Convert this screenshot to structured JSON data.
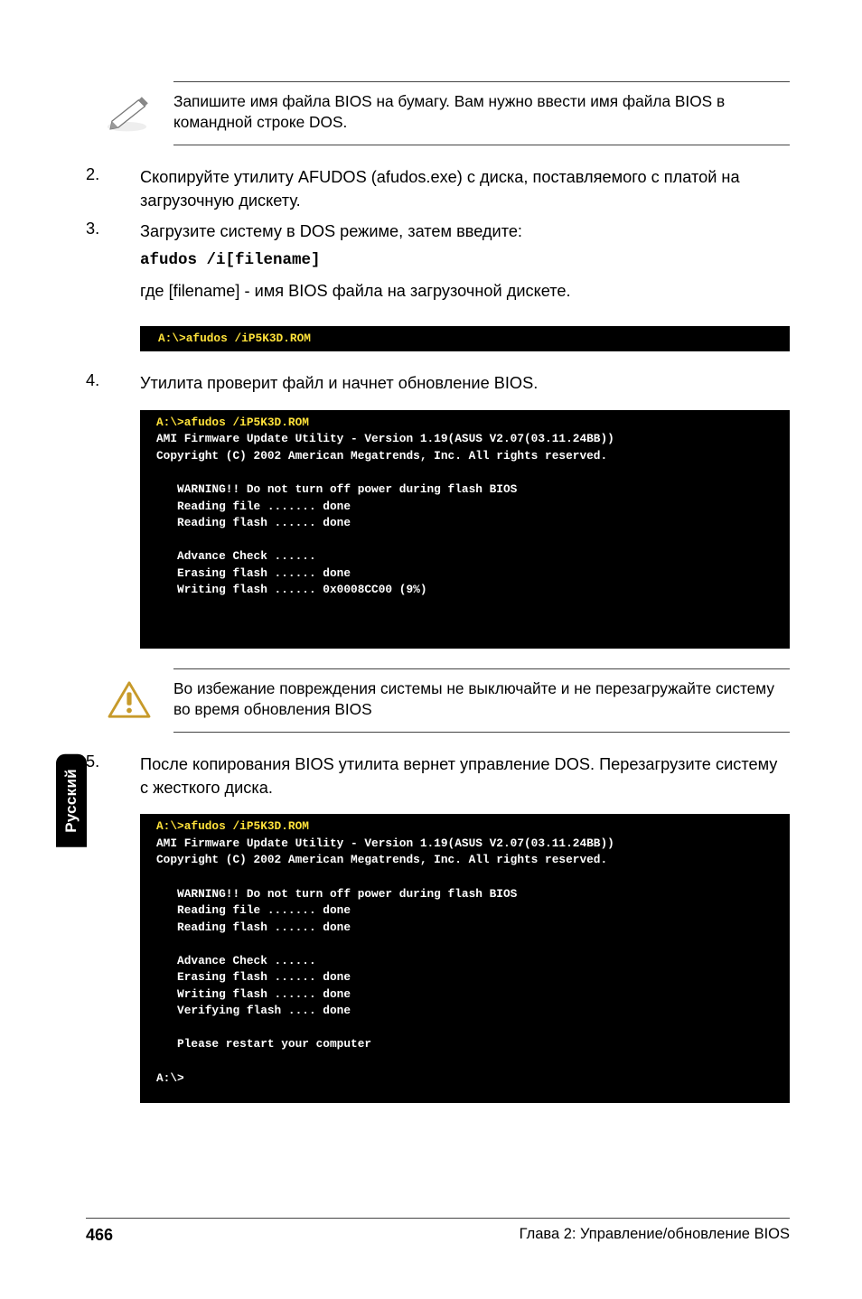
{
  "note": {
    "icon": "pencil-icon",
    "text": "Запишите имя файла BIOS на бумагу. Вам нужно ввести имя файла BIOS в командной строке DOS."
  },
  "step2": {
    "num": "2.",
    "text": "Скопируйте утилиту AFUDOS  (afudos.exe) с диска, поставляемого с платой на загрузочную дискету."
  },
  "step3": {
    "num": "3.",
    "text": "Загрузите систему в DOS режиме, затем введите:"
  },
  "cmd_example": "afudos /i[filename]",
  "where_line": "где [filename] - имя BIOS файла на загрузочной дискете.",
  "term1": {
    "cmd": "A:\\>afudos /iP5K3D.ROM"
  },
  "step4": {
    "num": "4.",
    "text": "Утилита проверит файл и начнет обновление BIOS."
  },
  "term2": {
    "cmd": "A:\\>afudos /iP5K3D.ROM",
    "line1": "AMI Firmware Update Utility - Version 1.19(ASUS V2.07(03.11.24BB))",
    "line2": "Copyright (C) 2002 American Megatrends, Inc. All rights reserved.",
    "b1": "   WARNING!! Do not turn off power during flash BIOS",
    "b2": "   Reading file ....... done",
    "b3": "   Reading flash ...... done",
    "b4": "   Advance Check ......",
    "b5": "   Erasing flash ...... done",
    "b6": "   Writing flash ...... 0x0008CC00 (9%)"
  },
  "warning": {
    "text": "Во избежание повреждения системы не выключайте и не перезагружайте систему во время обновления BIOS"
  },
  "step5": {
    "num": "5.",
    "text": "После копирования BIOS утилита вернет управление DOS. Перезагрузите систему с жесткого диска."
  },
  "term3": {
    "cmd": "A:\\>afudos /iP5K3D.ROM",
    "line1": "AMI Firmware Update Utility - Version 1.19(ASUS V2.07(03.11.24BB))",
    "line2": "Copyright (C) 2002 American Megatrends, Inc. All rights reserved.",
    "b1": "   WARNING!! Do not turn off power during flash BIOS",
    "b2": "   Reading file ....... done",
    "b3": "   Reading flash ...... done",
    "b4": "   Advance Check ......",
    "b5": "   Erasing flash ...... done",
    "b6": "   Writing flash ...... done",
    "b7": "   Verifying flash .... done",
    "b8": "   Please restart your computer",
    "prompt": "A:\\>"
  },
  "side_tab": "Русский",
  "footer": {
    "page": "466",
    "chapter": "Глава 2: Управление/обновление BIOS"
  }
}
